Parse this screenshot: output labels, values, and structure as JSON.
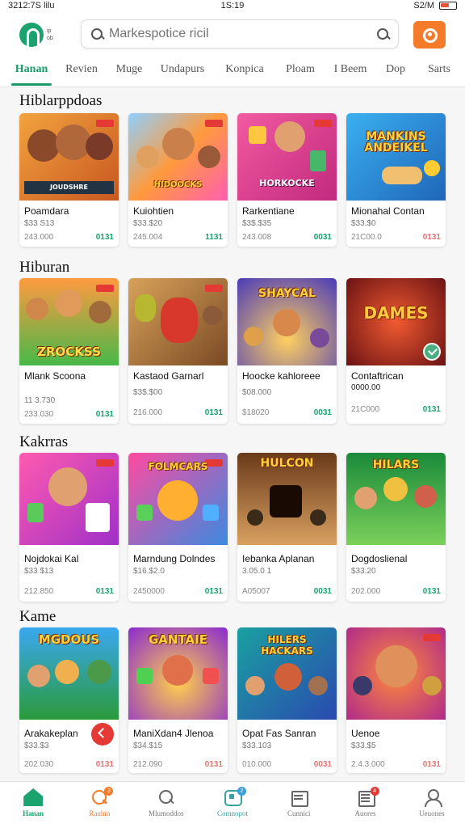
{
  "status_bar": {
    "left": "3212:7S lilu",
    "time": "1S:19",
    "right": "S2/M"
  },
  "header": {
    "logo_text": "ip ob",
    "search_placeholder": "Markespotice ricil"
  },
  "tabs": [
    "Hanan",
    "Revien",
    "Muge",
    "Undapurs",
    "Konpica",
    "Ploam",
    "I Beem",
    "Dop",
    "Sarts"
  ],
  "sections": [
    {
      "title": "Hiblarppdoas",
      "cards": [
        {
          "name": "Poamdara",
          "price": "$33 S13",
          "sub": "243.000",
          "deal": "0131",
          "banner": "JOUDSHRE",
          "bg": "#e9863a"
        },
        {
          "name": "Kuiohtien",
          "price": "$33.$20",
          "sub": "245.004",
          "deal": "1131",
          "banner": "HIDOOCKS",
          "bg": "#f7a43c"
        },
        {
          "name": "Rarkentiane",
          "price": "$3$.$35",
          "sub": "243.008",
          "deal": "0031",
          "banner": "HORKOCKE",
          "bg": "#d93f8c"
        },
        {
          "name": "Mionahal Contan",
          "price": "$33.$0",
          "sub": "21C00.0",
          "deal": "0131",
          "banner": "MANKINS ANDEIKEL",
          "bg": "#2f8fd8",
          "deal_red": true
        }
      ]
    },
    {
      "title": "Hiburan",
      "cards": [
        {
          "name": "Mlank Scoona",
          "price": "11 3.730",
          "sub": "233.030",
          "deal": "0131",
          "banner": "ZROCKSS",
          "bg": "#3fae4b"
        },
        {
          "name": "Kastaod Garnarl",
          "price": "$3$.$00",
          "sub": "216.000",
          "deal": "0131",
          "banner": "",
          "bg": "#c07d3f"
        },
        {
          "name": "Hoocke kahloreee",
          "price": "$08.000",
          "sub": "$18020",
          "deal": "0031",
          "banner": "SHAYCAL",
          "bg": "#5a4cd0"
        },
        {
          "name": "Contaftrican",
          "name2": "0000.00",
          "price": "",
          "sub": "21C000",
          "deal": "0131",
          "banner": "DAMES",
          "bg": "#b0272a",
          "check": true
        }
      ]
    },
    {
      "title": "Kakrras",
      "cards": [
        {
          "name": "Nojdokai Kal",
          "price": "$33 $13",
          "sub": "212.850",
          "deal": "0131",
          "banner": "",
          "bg": "#d8487c"
        },
        {
          "name": "Marndung Dolndes",
          "price": "$16.$2.0",
          "sub": "2450000",
          "deal": "0131",
          "banner": "FOLMCARS",
          "bg": "#d0338a"
        },
        {
          "name": "Iebanka Aplanan",
          "price": "3.05.0 1",
          "sub": "A05007",
          "deal": "0031",
          "banner": "HULCON",
          "bg": "#8a5a2f"
        },
        {
          "name": "Dogdoslienal",
          "price": "$33.20",
          "sub": "202.000",
          "deal": "0131",
          "banner": "HILARS",
          "bg": "#2f9a3e"
        }
      ]
    },
    {
      "title": "Kame",
      "cards": [
        {
          "name": "Arakakeplan",
          "price": "$33.$3",
          "sub": "202.030",
          "deal": "0131",
          "banner": "MGDOUS",
          "bg": "#2d8bd0",
          "fab": true,
          "deal_red": true
        },
        {
          "name": "ManiXdan4 Jlenoa",
          "price": "$34.$15",
          "sub": "212.090",
          "deal": "0131",
          "banner": "GANTAIE",
          "bg": "#9b3fd0",
          "deal_red": true
        },
        {
          "name": "Opat Fas Sanran",
          "price": "$33.103",
          "sub": "010.000",
          "deal": "0031",
          "banner": "HILERS HACKARS",
          "bg": "#1e8a8a",
          "deal_red": true
        },
        {
          "name": "Uenoe",
          "price": "$33.$5",
          "sub": "2.4.3.000",
          "deal": "0131",
          "banner": "",
          "bg": "#c23aa0",
          "deal_red": true
        }
      ]
    }
  ],
  "bottom_nav": [
    {
      "label": "Hanan",
      "icon": "home-icon",
      "active": true
    },
    {
      "label": "Rauhin",
      "icon": "chat-icon",
      "badge": "3"
    },
    {
      "label": "Mlumoddos",
      "icon": "search-icon"
    },
    {
      "label": "Comnopot",
      "icon": "store-icon",
      "badge": "2"
    },
    {
      "label": "Cunnici",
      "icon": "calendar-icon"
    },
    {
      "label": "Auores",
      "icon": "list-icon",
      "badge": "4"
    },
    {
      "label": "Ueuones",
      "icon": "user-icon"
    }
  ]
}
